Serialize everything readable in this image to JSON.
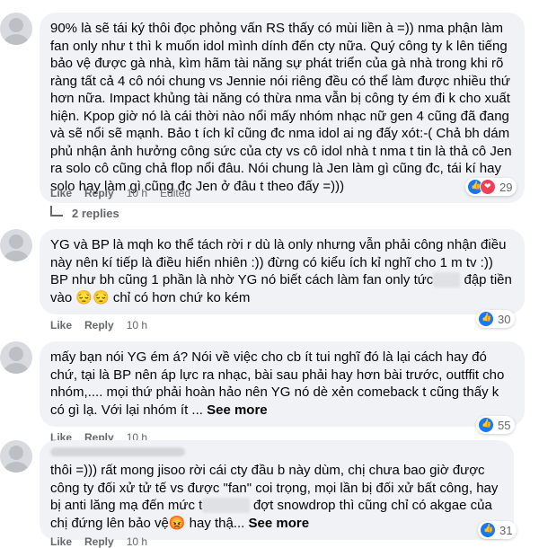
{
  "comments": [
    {
      "text_before": "90% là sẽ tái ký thôi đọc phỏng vấn RS thấy có mùi liền à =)) nma phận làm fan only như t thì k muốn idol mình dính đến cty nữa. Quý công ty k lên tiếng bảo vệ được gà nhà, kìm hãm tài năng sự phát triển của gà nhà trong khi rõ ràng tất cả 4 cô nói chung vs Jennie nói riêng đều có thể làm được nhiều thứ hơn nữa. Impact khủng tài năng có thừa nma vẫn bị công ty ém đi k cho xuất hiện. Kpop giờ nó là cái thời nào nổi mấy nhóm nhạc nữ gen 4 cũng đã đang và sẽ nổi sẽ mạnh. Bảo t ích kỉ cũng đc nma idol ai ng đấy xót:-( Chả bh dám phủ nhận ảnh hưởng công sức của cty vs cô idol nhà t nma t tin là thả cô Jen ra solo cô cũng chả flop nổi đâu. Nói chung là Jen làm gì cũng đc, tái kí hay solo hay làm gì cũng đc Jen ở đâu t theo đấy =)))",
      "like": "Like",
      "reply": "Reply",
      "time": "10 h",
      "edited": "Edited",
      "reactions": "29"
    },
    {
      "text_before": "YG và BP là mqh ko thể tách rời r dù là only nhưng vẫn phải công nhận điều này nên kí tiếp là điều hiển nhiên :)) đừng có kiểu ích kỉ nghĩ cho 1 m tv :)) BP như bh cũng 1 phần là nhờ YG nó biết cách làm fan only tức",
      "text_after": " đập tiền vào 😔😔 chỉ có hơn chứ ko kém",
      "like": "Like",
      "reply": "Reply",
      "time": "10 h",
      "reactions": "30"
    },
    {
      "text_before": "mấy bạn nói YG ém á? Nói về việc cho cb ít tui nghĩ đó là lại cách hay đó chứ, tại là BP nên áp lực ra nhạc, bài sau phải hay hơn bài trước, outffit cho nhóm,.... mọi thứ phải hoàn hảo nên YG nó dè xẻn comeback t cũng thấy k có gì lạ. Với lại nhóm ít ...",
      "see_more": "See more",
      "like": "Like",
      "reply": "Reply",
      "time": "10 h",
      "reactions": "55"
    },
    {
      "text_before": "thôi =))) rất mong jisoo rời cái cty đầu b này dùm, chị chưa bao giờ được công ty đối xử tử tế vs được \"fan\" coi trọng, mọi lần bị đối xử bất công, hay bị anti lăng mạ đến mức t",
      "text_after": " đợt snowdrop thì cũng chỉ có akgae của chị đứng lên bảo vệ😡 hay thậ...",
      "see_more": "See more",
      "like": "Like",
      "reply": "Reply",
      "time": "10 h",
      "reactions": "31"
    }
  ],
  "replies_label": "2 replies",
  "blur_placeholder_1": "xxxx",
  "blur_placeholder_2": "xxxxxxx"
}
